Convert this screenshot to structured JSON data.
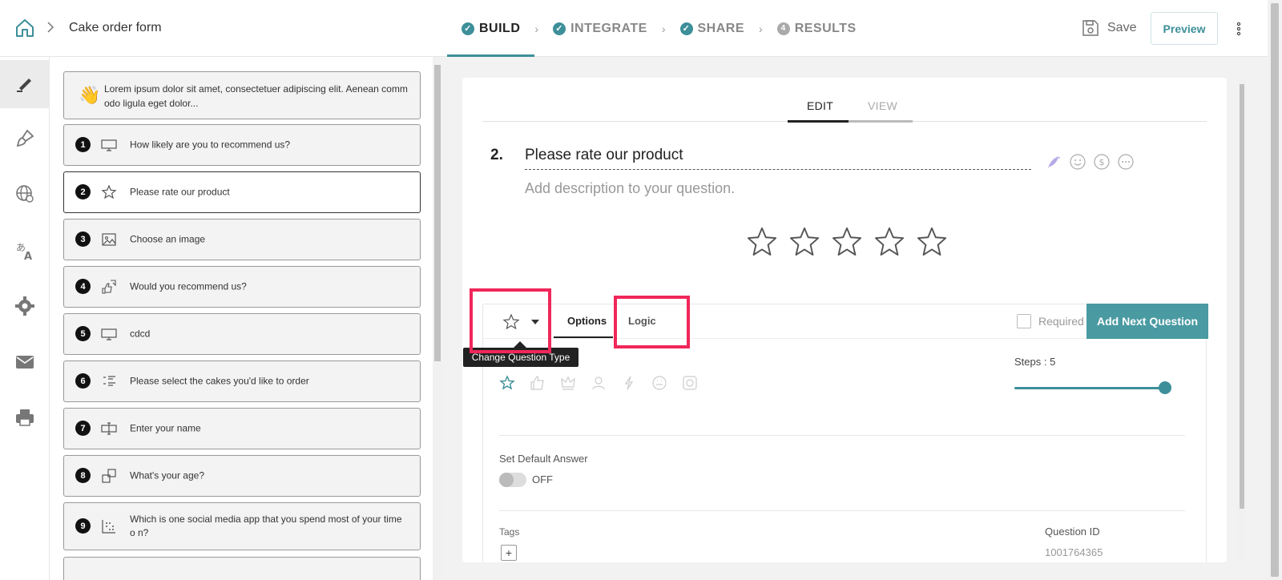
{
  "header": {
    "breadcrumb_title": "Cake order form",
    "steps": [
      {
        "label": "BUILD",
        "state": "done",
        "active": true
      },
      {
        "label": "INTEGRATE",
        "state": "done"
      },
      {
        "label": "SHARE",
        "state": "done"
      },
      {
        "label": "RESULTS",
        "state": "pending",
        "number": "4"
      }
    ],
    "save_label": "Save",
    "preview_label": "Preview"
  },
  "rail": {
    "items": [
      "pencil-icon",
      "brush-icon",
      "globe-icon",
      "translate-icon",
      "settings-icon",
      "mail-icon",
      "print-icon"
    ]
  },
  "questions": {
    "intro_text": "Lorem ipsum dolor sit amet, consectetuer adipiscing elit. Aenean comm odo ligula eget dolor...",
    "items": [
      {
        "num": "1",
        "icon": "nps-icon",
        "text": "How likely are you to recommend us?"
      },
      {
        "num": "2",
        "icon": "star-icon",
        "text": "Please rate our product"
      },
      {
        "num": "3",
        "icon": "image-icon",
        "text": "Choose an image"
      },
      {
        "num": "4",
        "icon": "thumbs-icon",
        "text": "Would you recommend us?"
      },
      {
        "num": "5",
        "icon": "nps-icon",
        "text": "cdcd"
      },
      {
        "num": "6",
        "icon": "choice-icon",
        "text": "Please select the cakes you'd like to order"
      },
      {
        "num": "7",
        "icon": "text-input-icon",
        "text": "Enter your name"
      },
      {
        "num": "8",
        "icon": "number-icon",
        "text": "What's your age?"
      },
      {
        "num": "9",
        "icon": "matrix-icon",
        "text": "Which is one social media app that you spend most of your time o n?"
      }
    ]
  },
  "editor": {
    "tab_edit": "EDIT",
    "tab_view": "VIEW",
    "question_number": "2.",
    "question_title": "Please rate our product",
    "description_placeholder": "Add description to your question.",
    "star_count": 5,
    "panel": {
      "tab_options": "Options",
      "tab_logic": "Logic",
      "required_label": "Required",
      "required_checked": false,
      "add_next_label": "Add Next Question",
      "steps_label": "Steps : 5",
      "steps_value": 5,
      "rating_icons": [
        "star-icon",
        "thumb-icon",
        "crown-icon",
        "user-icon",
        "bolt-icon",
        "smiley-icon",
        "circle-square-icon"
      ],
      "default_answer_label": "Set Default Answer",
      "toggle_text": "OFF",
      "tags_label": "Tags",
      "question_id_label": "Question ID",
      "question_id_value": "1001764365"
    },
    "tooltip": "Change Question Type"
  },
  "colors": {
    "accent": "#3d8f99",
    "highlight": "#f0275a"
  }
}
